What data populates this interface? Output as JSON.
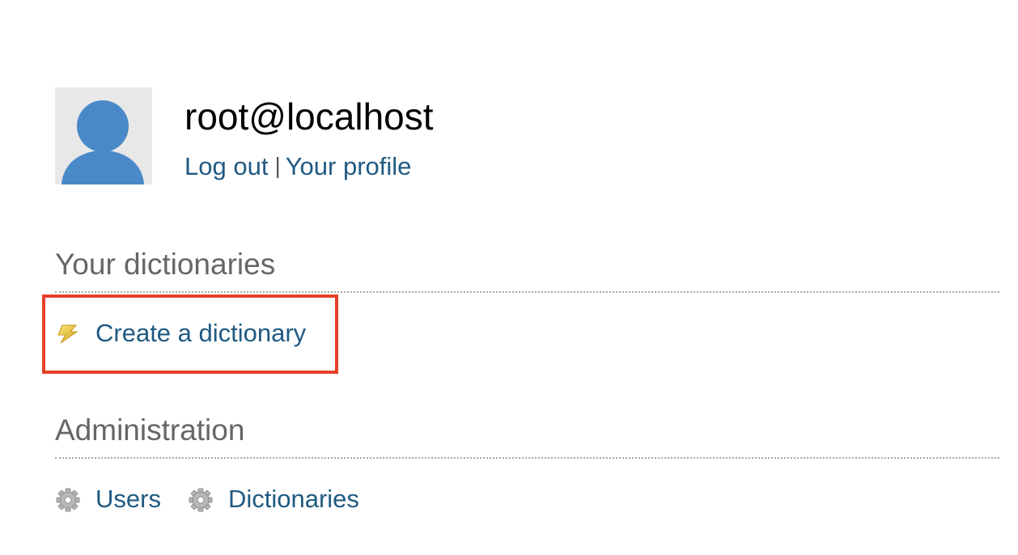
{
  "user": {
    "name": "root@localhost",
    "logout_label": "Log out",
    "separator": "|",
    "profile_label": "Your profile"
  },
  "dictionaries_section": {
    "title": "Your dictionaries",
    "create_label": "Create a dictionary",
    "create_icon": "lightning-icon"
  },
  "administration_section": {
    "title": "Administration",
    "users_label": "Users",
    "dictionaries_label": "Dictionaries",
    "item_icon": "gear-icon"
  },
  "colors": {
    "link": "#1f5a82",
    "section_title": "#666666",
    "avatar_fill": "#4a89c8",
    "highlight": "#e8402a"
  }
}
